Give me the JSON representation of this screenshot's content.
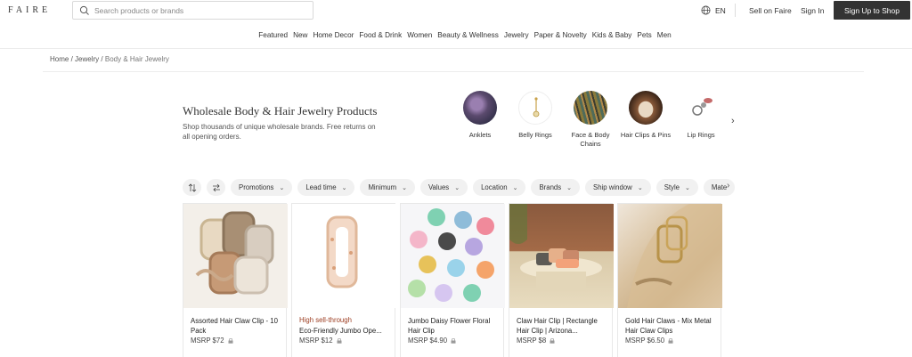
{
  "header": {
    "logo": "FAIRE",
    "search_placeholder": "Search products or brands",
    "language": "EN",
    "sell_link": "Sell on Faire",
    "signin_link": "Sign In",
    "signup_button": "Sign Up to Shop"
  },
  "nav": [
    "Featured",
    "New",
    "Home Decor",
    "Food & Drink",
    "Women",
    "Beauty & Wellness",
    "Jewelry",
    "Paper & Novelty",
    "Kids & Baby",
    "Pets",
    "Men"
  ],
  "breadcrumb": {
    "home": "Home",
    "sep1": "/",
    "jewelry": "Jewelry",
    "sep2": "/",
    "current": "Body & Hair Jewelry"
  },
  "hero": {
    "title": "Wholesale Body & Hair Jewelry Products",
    "subtitle": "Shop thousands of unique wholesale brands. Free returns on all opening orders."
  },
  "categories": [
    {
      "label": "Anklets",
      "color": "#6b5a7a"
    },
    {
      "label": "Belly Rings",
      "color": "#e9e6dd"
    },
    {
      "label": "Face & Body Chains",
      "color": "#7a6a3e"
    },
    {
      "label": "Hair Clips & Pins",
      "color": "#6e4a32"
    },
    {
      "label": "Lip Rings",
      "color": "#c8c8c8"
    }
  ],
  "filters": [
    "Promotions",
    "Lead time",
    "Minimum",
    "Values",
    "Location",
    "Brands",
    "Ship window",
    "Style",
    "Mate"
  ],
  "products": [
    {
      "badge": "",
      "name": "Assorted Hair Claw Clip - 10 Pack",
      "price": "MSRP $72"
    },
    {
      "badge": "High sell-through",
      "name": "Eco-Friendly Jumbo Ope...",
      "price": "MSRP $12"
    },
    {
      "badge": "",
      "name": "Jumbo Daisy Flower Floral Hair Clip",
      "price": "MSRP $4.90"
    },
    {
      "badge": "",
      "name": "Claw Hair Clip | Rectangle Hair Clip | Arizona...",
      "price": "MSRP $8"
    },
    {
      "badge": "",
      "name": "Gold Hair Claws - Mix Metal Hair Claw Clips",
      "price": "MSRP $6.50"
    }
  ],
  "colors": {
    "signup_bg": "#333333",
    "badge": "#9b3b1f",
    "chip_bg": "#f1f1f1"
  }
}
